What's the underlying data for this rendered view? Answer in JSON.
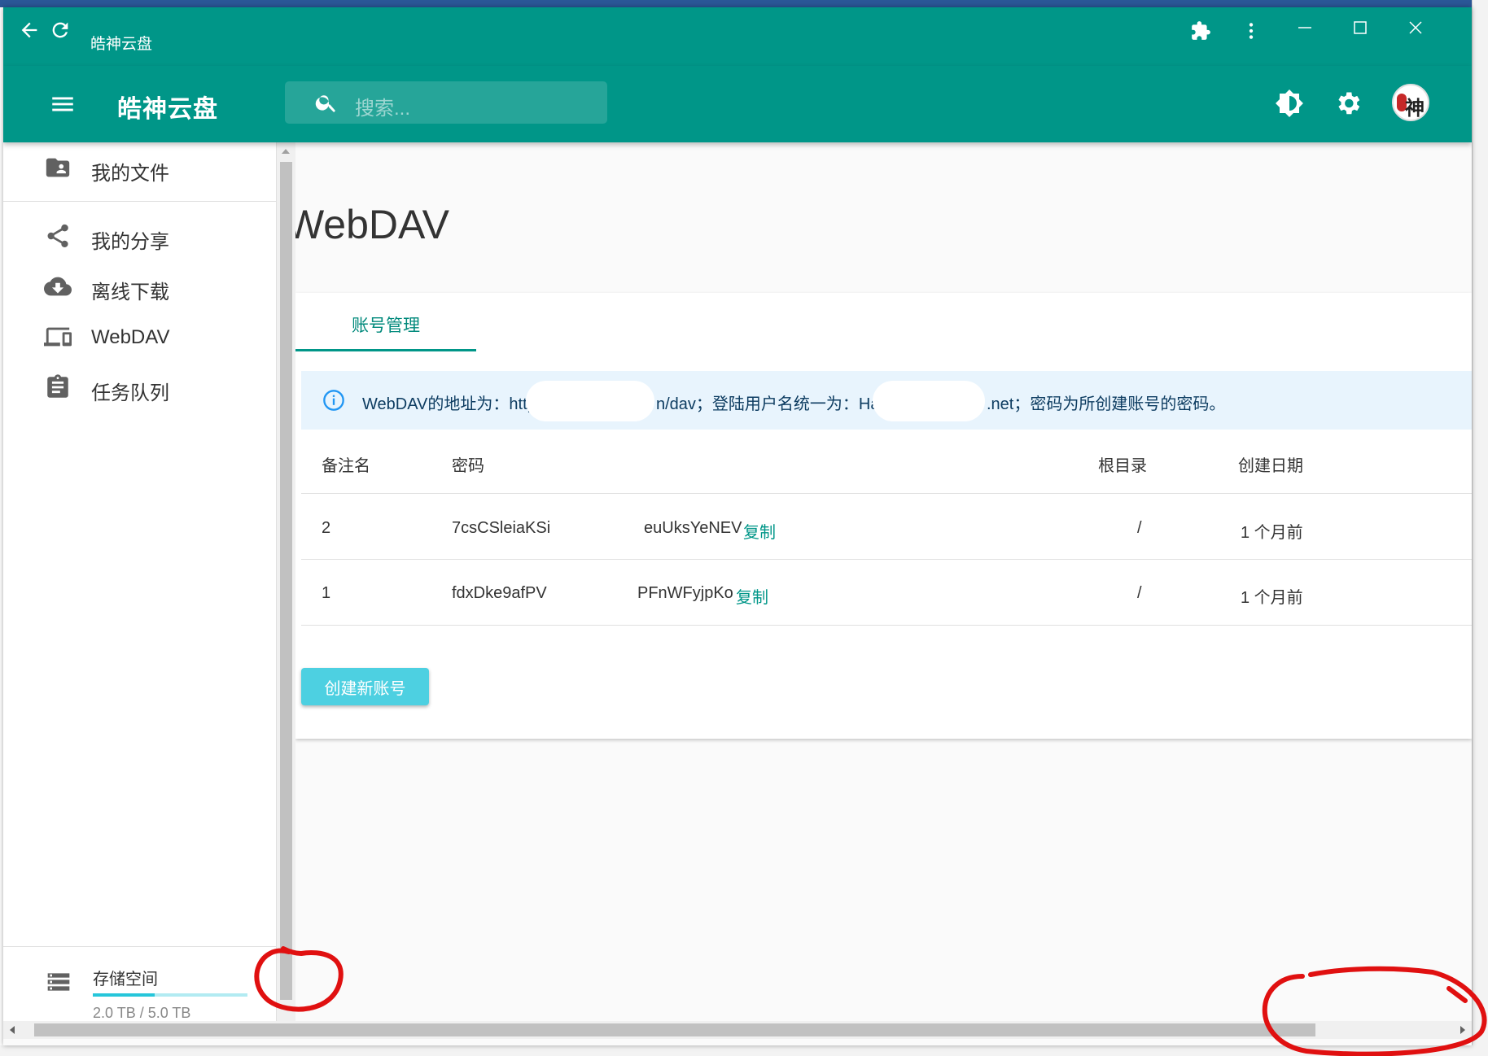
{
  "titlebar": {
    "title": "皓神云盘",
    "icons": [
      "back-arrow-icon",
      "refresh-icon",
      "extension-icon",
      "more-vert-icon",
      "minimize-icon",
      "maximize-icon",
      "close-icon"
    ]
  },
  "appbar": {
    "title": "皓神云盘",
    "search_placeholder": "搜索...",
    "icons": [
      "menu-icon",
      "search-icon",
      "brightness-icon",
      "settings-icon"
    ],
    "avatar_glyph": "神"
  },
  "sidebar": {
    "items": [
      {
        "label": "我的文件",
        "icon": "folder-shared-icon"
      },
      {
        "label": "我的分享",
        "icon": "share-icon"
      },
      {
        "label": "离线下载",
        "icon": "cloud-download-icon"
      },
      {
        "label": "WebDAV",
        "icon": "devices-icon"
      },
      {
        "label": "任务队列",
        "icon": "assignment-icon"
      }
    ],
    "storage": {
      "label": "存储空间",
      "value": "2.0 TB / 5.0 TB",
      "used_fraction": 0.4,
      "icon": "storage-icon"
    }
  },
  "main": {
    "page_title": "WebDAV",
    "tab_label": "账号管理",
    "info": {
      "icon": "info-icon",
      "part1": "WebDAV的地址为：https:/",
      "part2": "n/dav；登陆用户名统一为：HaoS",
      "part3": ".net；密码为所创建账号的密码。"
    },
    "table": {
      "headers": {
        "name": "备注名",
        "password": "密码",
        "root": "根目录",
        "created": "创建日期"
      },
      "rows": [
        {
          "name": "2",
          "pw_left": "7csCSleiaKSi",
          "pw_right": "euUksYeNEV",
          "copy": "复制",
          "root": "/",
          "created": "1 个月前"
        },
        {
          "name": "1",
          "pw_left": "fdxDke9afPV",
          "pw_right": "PFnWFyjpKo",
          "copy": "复制",
          "root": "/",
          "created": "1 个月前"
        }
      ]
    },
    "create_button": "创建新账号"
  },
  "colors": {
    "primary": "#009688",
    "accent_button": "#4dd0e1",
    "info_bg": "#e8f4fd",
    "info_text": "#0d3c61"
  }
}
